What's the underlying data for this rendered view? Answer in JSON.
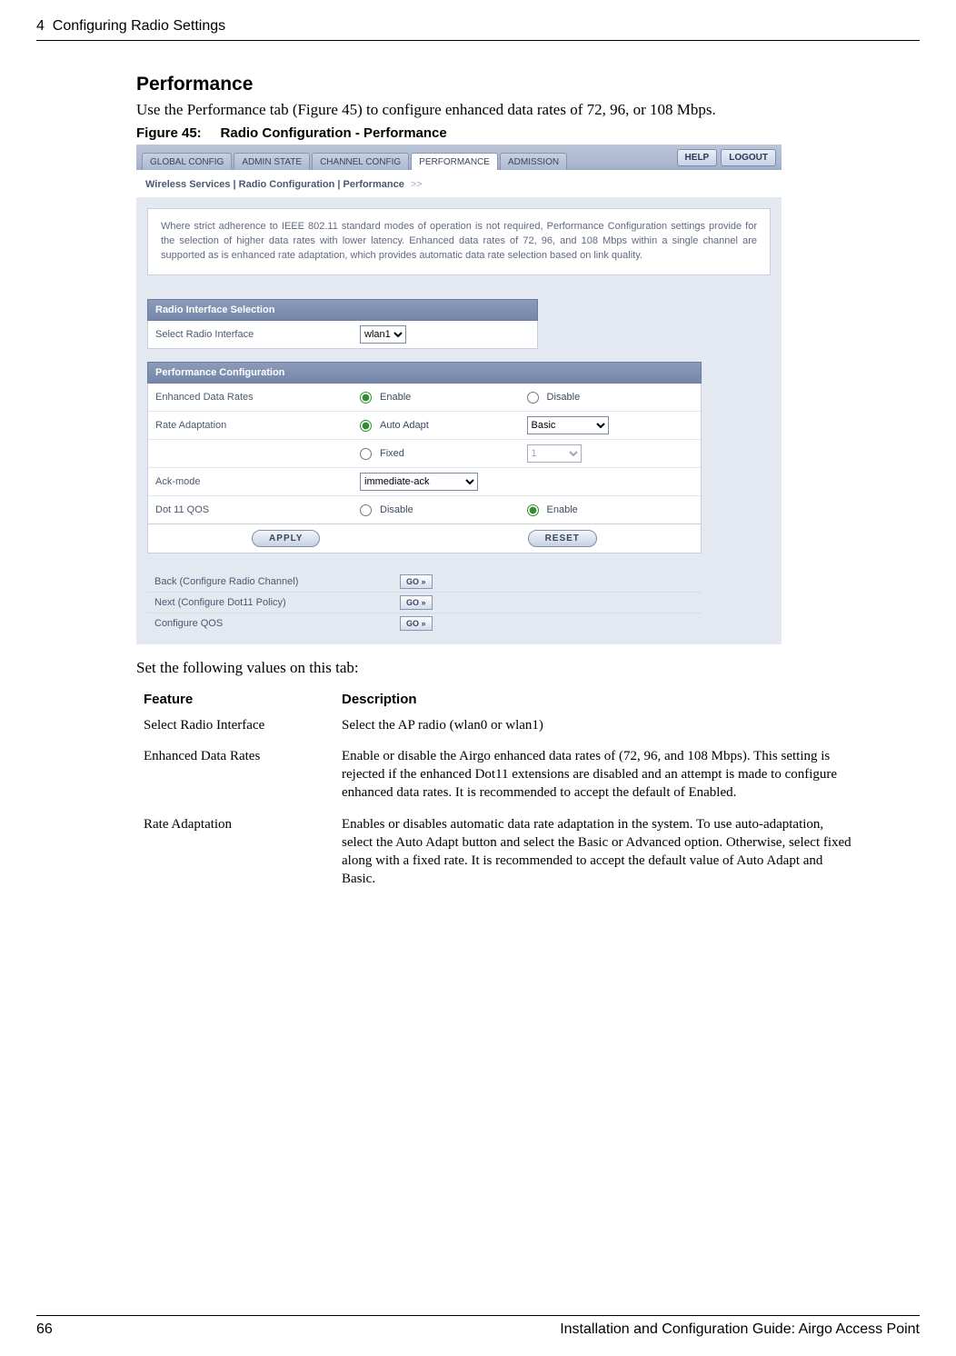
{
  "header": {
    "chapter_number": "4",
    "chapter_title": "Configuring Radio Settings"
  },
  "section_title": "Performance",
  "intro_text": "Use the Performance tab (Figure 45) to configure enhanced data rates of 72, 96, or 108 Mbps.",
  "figure_caption_label": "Figure 45:",
  "figure_caption_text": "Radio Configuration - Performance",
  "figure": {
    "tabs": {
      "global": "GLOBAL CONFIG",
      "admin": "ADMIN STATE",
      "channel": "CHANNEL CONFIG",
      "performance": "PERFORMANCE",
      "admission": "ADMISSION"
    },
    "help_label": "HELP",
    "logout_label": "LOGOUT",
    "breadcrumb": "Wireless Services | Radio Configuration | Performance",
    "breadcrumb_arrow": ">>",
    "info_box": "Where strict adherence to IEEE 802.11 standard modes of operation is not required, Performance Configuration settings provide for the selection of higher data rates with lower latency. Enhanced data rates of 72, 96, and 108 Mbps within a single channel are supported as is enhanced rate adaptation, which provides automatic data rate selection based on link quality.",
    "radio_iface_panel": "Radio Interface Selection",
    "select_radio_label": "Select Radio Interface",
    "select_radio_value": "wlan1",
    "perf_panel": "Performance Configuration",
    "enhanced_rates_label": "Enhanced Data Rates",
    "enable_label": "Enable",
    "disable_label": "Disable",
    "rate_adapt_label": "Rate Adaptation",
    "auto_adapt_label": "Auto Adapt",
    "rate_adapt_sel_value": "Basic",
    "fixed_label": "Fixed",
    "fixed_sel_value": "1",
    "ack_label": "Ack-mode",
    "ack_value": "immediate-ack",
    "qos_label": "Dot 11 QOS",
    "apply_label": "APPLY",
    "reset_label": "RESET",
    "nav_back": "Back (Configure Radio Channel)",
    "nav_next": "Next (Configure Dot11 Policy)",
    "nav_qos": "Configure QOS",
    "go_label": "GO »"
  },
  "instr": "Set the following values on this tab:",
  "table": {
    "h1": "Feature",
    "h2": "Description",
    "rows": [
      {
        "feature": "Select Radio Interface",
        "desc": "Select the AP radio (wlan0 or wlan1)"
      },
      {
        "feature": "Enhanced Data Rates",
        "desc": "Enable or disable the Airgo enhanced data rates of (72, 96, and 108 Mbps). This setting is rejected if the enhanced Dot11 extensions are disabled and an attempt is made to configure enhanced data rates. It is recommended to accept the default of Enabled."
      },
      {
        "feature": "Rate Adaptation",
        "desc": "Enables or disables automatic data rate adaptation in the system. To use auto-adaptation, select the Auto Adapt button and select the Basic or Advanced option. Otherwise, select fixed along with a fixed rate. It is recommended to accept the default value of Auto Adapt and Basic."
      }
    ]
  },
  "footer": {
    "page": "66",
    "book": "Installation and Configuration Guide: Airgo Access Point"
  }
}
